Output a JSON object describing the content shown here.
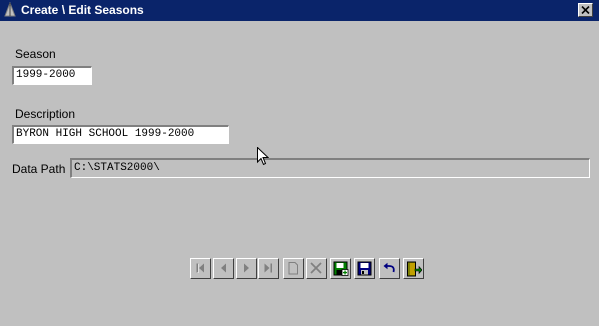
{
  "window": {
    "title": "Create \\ Edit Seasons"
  },
  "form": {
    "season_label": "Season",
    "season_value": "1999-2000",
    "description_label": "Description",
    "description_value": "BYRON HIGH SCHOOL 1999-2000",
    "datapath_label": "Data Path",
    "datapath_value": "C:\\STATS2000\\"
  },
  "toolbar": {
    "buttons": [
      {
        "name": "first-record",
        "icon": "first-icon",
        "enabled": false
      },
      {
        "name": "previous-record",
        "icon": "previous-icon",
        "enabled": false
      },
      {
        "name": "next-record",
        "icon": "next-icon",
        "enabled": false
      },
      {
        "name": "last-record",
        "icon": "last-icon",
        "enabled": false
      },
      {
        "name": "new-record",
        "icon": "new-page-icon",
        "enabled": false
      },
      {
        "name": "delete-record",
        "icon": "delete-x-icon",
        "enabled": false
      },
      {
        "name": "add-record",
        "icon": "save-add-icon",
        "enabled": true
      },
      {
        "name": "save-record",
        "icon": "floppy-disk-icon",
        "enabled": true
      },
      {
        "name": "undo",
        "icon": "undo-icon",
        "enabled": true
      },
      {
        "name": "exit",
        "icon": "exit-door-icon",
        "enabled": true
      }
    ]
  }
}
